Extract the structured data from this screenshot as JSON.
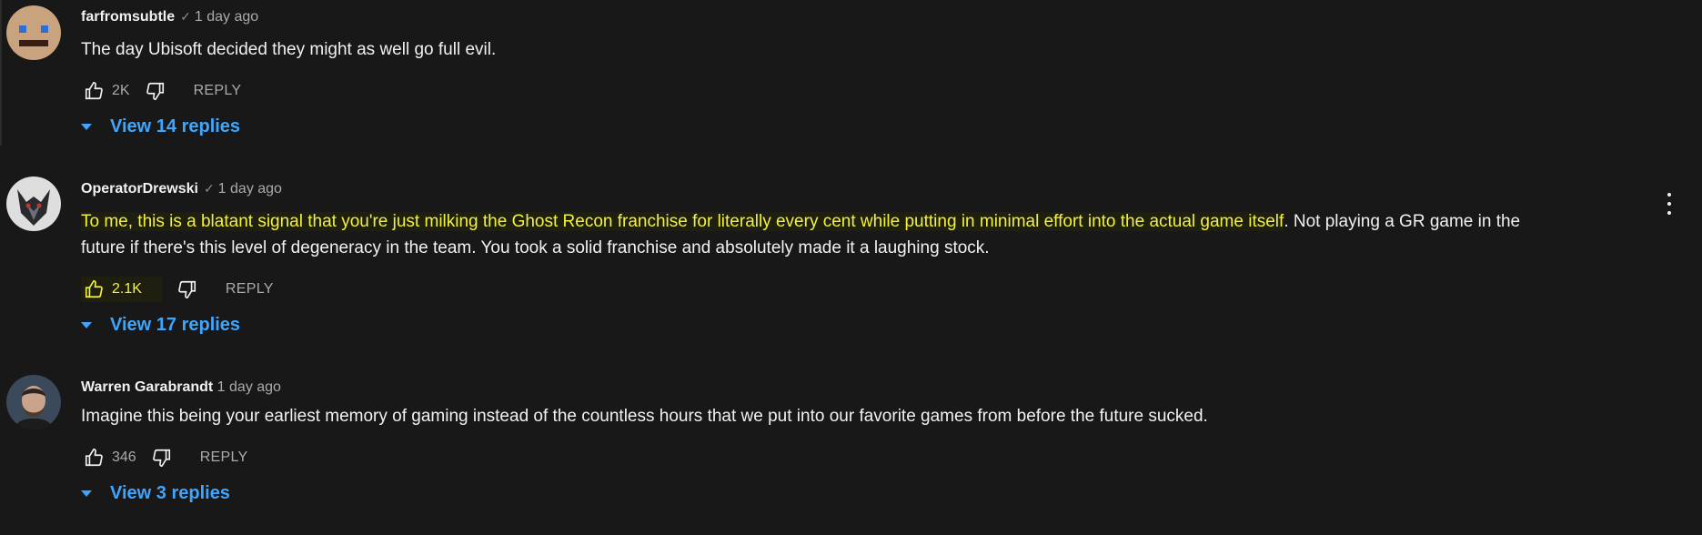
{
  "comments": [
    {
      "author": "farfromsubtle",
      "verified_mark": "✓",
      "time": "1 day ago",
      "text_plain": "The day Ubisoft decided they might as well go full evil.",
      "likes": "2K",
      "reply_label": "REPLY",
      "view_replies": "View 14 replies",
      "avatar_icon": "cartoon-face-avatar"
    },
    {
      "author": "OperatorDrewski",
      "verified_mark": "✓",
      "time": "1 day ago",
      "text_highlighted": "To me, this is a blatant signal that you're just milking the Ghost Recon franchise for literally every cent while putting in minimal effort into the actual game itself",
      "text_after_highlight": ". Not playing a GR game in the",
      "text_line2": "future if there's this level of degeneracy in the team. You took a solid franchise and absolutely made it a laughing stock.",
      "likes": "2.1K",
      "reply_label": "REPLY",
      "view_replies": "View 17 replies",
      "avatar_icon": "wolf-avatar",
      "highlight_color": "#f2f23a"
    },
    {
      "author": "Warren Garabrandt",
      "time": "1 day ago",
      "text_plain": "Imagine this being your earliest memory of gaming instead of the countless hours that we put into our favorite games from before the future sucked.",
      "likes": "346",
      "reply_label": "REPLY",
      "view_replies": "View 3 replies",
      "avatar_icon": "person-photo-avatar"
    }
  ],
  "colors": {
    "background": "#181818",
    "link_blue": "#3ea6ff",
    "secondary_text": "#aaaaaa"
  }
}
